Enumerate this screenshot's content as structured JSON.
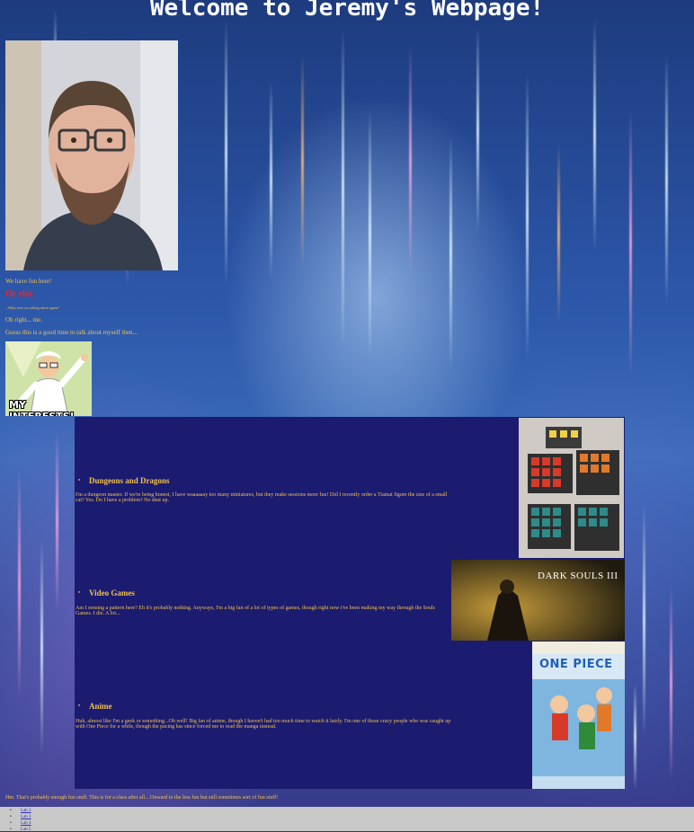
{
  "page": {
    "title": "Welcome to Jeremy's Webpage!"
  },
  "intro": {
    "line1": "We have fun here!",
    "line2": "Or else.",
    "line3": "...What were we talking about again?",
    "line4": "Oh right... me.",
    "line5": "Guess this is a good time to talk about myself then..."
  },
  "meme": {
    "caption": "MY INTERESTS!"
  },
  "interests": [
    {
      "title": "Dungeons and Dragons",
      "text": "I'm a dungeon master. If we're being honest, I have waaaaaay too many miniatures, but they make sessions more fun! Did I recently order a Tiamat figure the size of a small cat? Yes. Do I have a problem? No shut up."
    },
    {
      "title": "Video Games",
      "text": "Am I sensing a pattern here? Eh it's probably nothing. Anyways, I'm a big fan of a lot of types of games, though right now i've been making my way through the Souls Games. I die. A lot..."
    },
    {
      "title": "Anime",
      "text": "Huh, almost like I'm a geek or something...Oh well! Big fan of anime, though I haven't had too much time to watch it lately. I'm one of those crazy people who was caught up with One Piece for a while, though the pacing has since forced me to read the manga instead."
    }
  ],
  "game_cover": {
    "title": "DARK SOULS III"
  },
  "manga_cover": {
    "title": "ONE PIECE"
  },
  "footer": {
    "text": "Hm. That's probably enough fun stuff. This is for a class after all... Onward to the less fun but still sometimes sort of fun stuff!"
  },
  "nav": {
    "links": [
      "Lab 2",
      "Lab 3",
      "Lab 4",
      "Lab 5"
    ]
  }
}
